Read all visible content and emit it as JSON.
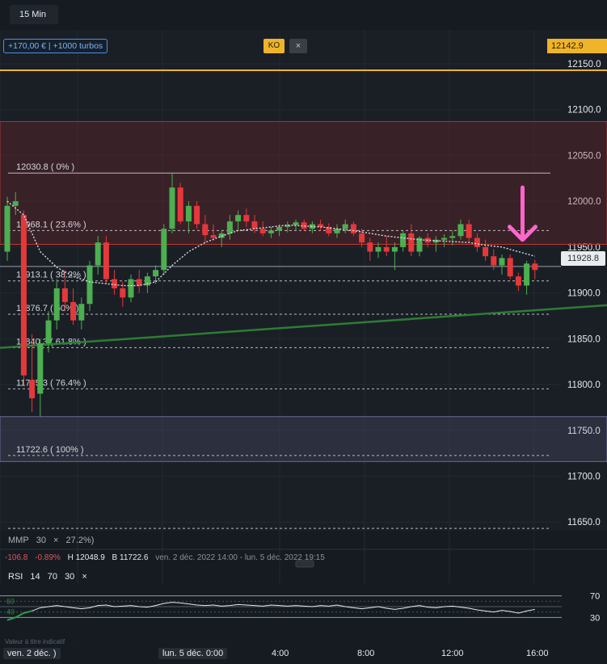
{
  "timeframe": "15 Min",
  "turbo_label": "+170,00 € | +1000 turbos",
  "ko": {
    "label": "KO",
    "close": "×",
    "price_label": "12142.9",
    "price": 12142.9
  },
  "last_price": {
    "label": "11928.8",
    "value": 11928.8
  },
  "colors": {
    "up": "#4caf50",
    "down": "#e5383b",
    "trend": "#2e7d32",
    "ko_line": "#f0b42a",
    "arrow": "#ff66cc"
  },
  "mmp": {
    "label": "MMP",
    "period": "30",
    "close": "×",
    "fib_clip": "27.2%)"
  },
  "info": {
    "change": "-106.8",
    "change_pct": "-0.89%",
    "high": "H 12048.9",
    "low": "B 11722.6",
    "range": "ven. 2 déc. 2022 14:00 - lun. 5 déc. 2022 19:15"
  },
  "rsi": {
    "label": "RSI",
    "p1": "14",
    "p2": "70",
    "p3": "30",
    "close": "×"
  },
  "indicator_note": "Valeur à titre indicatif",
  "x_ticks": [
    {
      "label": "ven. 2 déc. )",
      "boxed": true
    },
    {
      "label": "lun. 5 déc. 0:00",
      "boxed": true
    },
    {
      "label": "4:00",
      "boxed": false
    },
    {
      "label": "8:00",
      "boxed": false
    },
    {
      "label": "12:00",
      "boxed": false
    },
    {
      "label": "16:00",
      "boxed": false
    }
  ],
  "chart_data": {
    "type": "candlestick",
    "y_ticks": [
      11650,
      11700,
      11750,
      11800,
      11850,
      11900,
      11950,
      12000,
      12050,
      12100,
      12150
    ],
    "y_tick_labels": [
      "11650.0",
      "11700.0",
      "11750.0",
      "11800.0",
      "11850.0",
      "11900.0",
      "11950.0",
      "12000.0",
      "12050.0",
      "12100.0",
      "12150.0"
    ],
    "ylim": [
      11607,
      12187
    ],
    "fibonacci": [
      {
        "value": 12030.8,
        "label": "12030.8 ( 0% )"
      },
      {
        "value": 11968.1,
        "label": "11968.1 ( 23.6% )"
      },
      {
        "value": 11913.1,
        "label": "11913.1 ( 38.2% )"
      },
      {
        "value": 11876.7,
        "label": "11876.7 ( 50% )"
      },
      {
        "value": 11840.3,
        "label": "11840.3 ( 61.8% )"
      },
      {
        "value": 11795.3,
        "label": "11795.3 ( 76.4% )"
      },
      {
        "value": 11722.6,
        "label": "11722.6 ( 100% )"
      },
      {
        "value": 11643,
        "label": ""
      }
    ],
    "zones": [
      {
        "from": 11953,
        "to": 12087,
        "kind": "resistance"
      },
      {
        "from": 11716,
        "to": 11765,
        "kind": "support"
      }
    ],
    "resistance_line": 11953,
    "trendline": [
      [
        0,
        11840
      ],
      [
        75,
        11888
      ]
    ],
    "candles": [
      [
        11945,
        12005,
        11935,
        11995
      ],
      [
        11995,
        12010,
        11985,
        12000
      ],
      [
        11985,
        11990,
        11800,
        11810
      ],
      [
        11805,
        11855,
        11770,
        11785
      ],
      [
        11790,
        11850,
        11765,
        11845
      ],
      [
        11845,
        11880,
        11835,
        11870
      ],
      [
        11870,
        11915,
        11860,
        11905
      ],
      [
        11905,
        11925,
        11880,
        11890
      ],
      [
        11890,
        11905,
        11865,
        11870
      ],
      [
        11870,
        11895,
        11860,
        11888
      ],
      [
        11888,
        11935,
        11880,
        11930
      ],
      [
        11930,
        11962,
        11920,
        11955
      ],
      [
        11955,
        11962,
        11910,
        11915
      ],
      [
        11915,
        11925,
        11898,
        11905
      ],
      [
        11905,
        11912,
        11885,
        11895
      ],
      [
        11895,
        11920,
        11890,
        11915
      ],
      [
        11915,
        11925,
        11900,
        11908
      ],
      [
        11908,
        11922,
        11900,
        11918
      ],
      [
        11918,
        11930,
        11910,
        11925
      ],
      [
        11925,
        11975,
        11920,
        11970
      ],
      [
        11970,
        12030,
        11965,
        12015
      ],
      [
        12015,
        12020,
        11975,
        11978
      ],
      [
        11978,
        12000,
        11965,
        11995
      ],
      [
        11995,
        12000,
        11970,
        11975
      ],
      [
        11975,
        11985,
        11955,
        11963
      ],
      [
        11963,
        11975,
        11957,
        11960
      ],
      [
        11960,
        11968,
        11950,
        11965
      ],
      [
        11965,
        11985,
        11958,
        11978
      ],
      [
        11978,
        11990,
        11968,
        11985
      ],
      [
        11985,
        11992,
        11972,
        11978
      ],
      [
        11978,
        11985,
        11965,
        11970
      ],
      [
        11970,
        11978,
        11962,
        11965
      ],
      [
        11965,
        11972,
        11960,
        11968
      ],
      [
        11968,
        11975,
        11962,
        11972
      ],
      [
        11972,
        11978,
        11966,
        11974
      ],
      [
        11974,
        11980,
        11968,
        11977
      ],
      [
        11977,
        11980,
        11968,
        11970
      ],
      [
        11970,
        11978,
        11965,
        11975
      ],
      [
        11975,
        11980,
        11968,
        11972
      ],
      [
        11972,
        11976,
        11962,
        11965
      ],
      [
        11965,
        11975,
        11960,
        11970
      ],
      [
        11970,
        11980,
        11965,
        11975
      ],
      [
        11975,
        11978,
        11962,
        11965
      ],
      [
        11965,
        11970,
        11950,
        11955
      ],
      [
        11955,
        11960,
        11935,
        11945
      ],
      [
        11945,
        11955,
        11938,
        11950
      ],
      [
        11950,
        11962,
        11940,
        11945
      ],
      [
        11945,
        11955,
        11925,
        11950
      ],
      [
        11950,
        11968,
        11945,
        11965
      ],
      [
        11965,
        11975,
        11940,
        11945
      ],
      [
        11945,
        11962,
        11940,
        11960
      ],
      [
        11960,
        11965,
        11950,
        11955
      ],
      [
        11955,
        11962,
        11945,
        11958
      ],
      [
        11958,
        11964,
        11950,
        11960
      ],
      [
        11960,
        11968,
        11952,
        11962
      ],
      [
        11962,
        11980,
        11958,
        11975
      ],
      [
        11975,
        11980,
        11955,
        11960
      ],
      [
        11960,
        11965,
        11945,
        11950
      ],
      [
        11950,
        11958,
        11935,
        11940
      ],
      [
        11940,
        11948,
        11925,
        11930
      ],
      [
        11930,
        11942,
        11920,
        11938
      ],
      [
        11938,
        11942,
        11915,
        11918
      ],
      [
        11918,
        11922,
        11902,
        11908
      ],
      [
        11908,
        11935,
        11898,
        11932
      ],
      [
        11932,
        11936,
        11915,
        11925
      ]
    ],
    "moving_average": [
      [
        0,
        12000
      ],
      [
        2,
        11985
      ],
      [
        4,
        11945
      ],
      [
        6,
        11928
      ],
      [
        8,
        11918
      ],
      [
        10,
        11912
      ],
      [
        12,
        11910
      ],
      [
        14,
        11908
      ],
      [
        16,
        11908
      ],
      [
        18,
        11912
      ],
      [
        20,
        11930
      ],
      [
        22,
        11945
      ],
      [
        24,
        11955
      ],
      [
        26,
        11962
      ],
      [
        28,
        11968
      ],
      [
        30,
        11970
      ],
      [
        32,
        11972
      ],
      [
        34,
        11974
      ],
      [
        36,
        11973
      ],
      [
        38,
        11972
      ],
      [
        40,
        11970
      ],
      [
        42,
        11968
      ],
      [
        44,
        11965
      ],
      [
        46,
        11962
      ],
      [
        48,
        11960
      ],
      [
        50,
        11958
      ],
      [
        52,
        11957
      ],
      [
        54,
        11956
      ],
      [
        56,
        11955
      ],
      [
        58,
        11952
      ],
      [
        60,
        11950
      ],
      [
        62,
        11945
      ],
      [
        64,
        11940
      ]
    ],
    "arrow_at": {
      "index": 62.5,
      "top": 12015,
      "bottom": 11958
    },
    "rsi_levels": [
      70,
      60,
      50,
      40,
      30
    ],
    "rsi_level_labels": [
      "70",
      "30"
    ],
    "rsi_left_labels": [
      "60",
      "40"
    ],
    "rsi_values": [
      25,
      30,
      38,
      42,
      48,
      50,
      52,
      50,
      48,
      46,
      48,
      52,
      53,
      50,
      51,
      52,
      50,
      49,
      52,
      56,
      58,
      57,
      55,
      53,
      52,
      53,
      51,
      52,
      54,
      53,
      52,
      51,
      53,
      52,
      51,
      52,
      51,
      50,
      52,
      51,
      53,
      50,
      48,
      46,
      48,
      50,
      47,
      45,
      47,
      50,
      52,
      49,
      48,
      50,
      51,
      49,
      47,
      44,
      42,
      40,
      43,
      41,
      38,
      42,
      45
    ]
  }
}
